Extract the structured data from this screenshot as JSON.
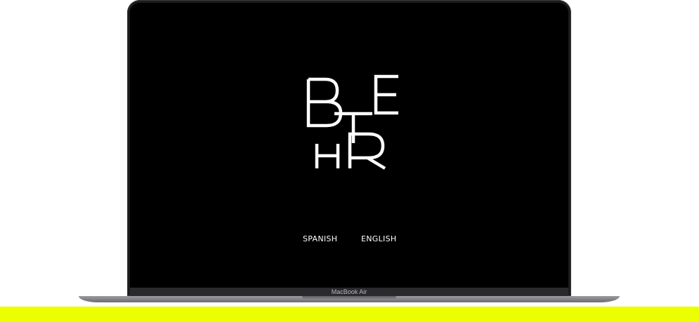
{
  "device": {
    "model_label": "MacBook Air"
  },
  "logo": {
    "letters": [
      "B",
      "T",
      "E",
      "H",
      "R"
    ],
    "color": "#ffffff"
  },
  "language_switcher": {
    "spanish_label": "SPANISH",
    "english_label": "ENGLISH"
  },
  "colors": {
    "screen_background": "#000000",
    "text": "#ffffff",
    "accent_band": "#ecff00",
    "laptop_body": "#1c1c1e"
  }
}
